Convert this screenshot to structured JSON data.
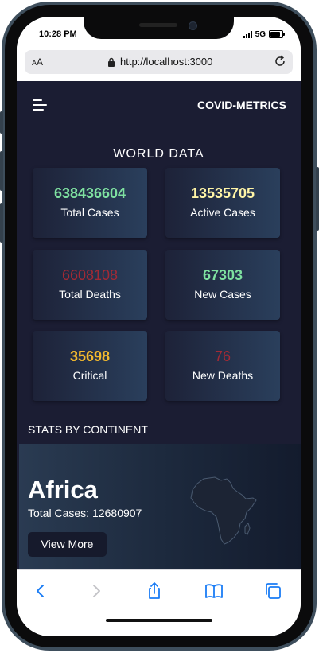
{
  "status_bar": {
    "time": "10:28 PM",
    "network": "5G"
  },
  "browser": {
    "aa_label_small": "A",
    "aa_label_large": "A",
    "url": "http://localhost:3000"
  },
  "header": {
    "brand": "COVID-METRICS"
  },
  "world_data": {
    "title": "WORLD DATA",
    "stats": [
      {
        "value": "638436604",
        "label": "Total Cases",
        "color": "#7ee0a0"
      },
      {
        "value": "13535705",
        "label": "Active Cases",
        "color": "#fff4a6"
      },
      {
        "value": "6608108",
        "label": "Total Deaths",
        "color": "#a32a35"
      },
      {
        "value": "67303",
        "label": "New Cases",
        "color": "#7ee0a0"
      },
      {
        "value": "35698",
        "label": "Critical",
        "color": "#f2b92e"
      },
      {
        "value": "76",
        "label": "New Deaths",
        "color": "#a32a35"
      }
    ]
  },
  "continents": {
    "title": "STATS BY CONTINENT",
    "items": [
      {
        "name": "Africa",
        "total_label": "Total Cases:",
        "total_value": "12680907",
        "button": "View More"
      }
    ]
  },
  "colors": {
    "app_bg": "#1b1d33",
    "card_start": "#1d2238",
    "card_end": "#2a3f5c",
    "ios_blue": "#1a7cf5"
  },
  "icons": [
    "hamburger-icon",
    "lock-icon",
    "reload-icon",
    "back-icon",
    "forward-icon",
    "share-icon",
    "bookmarks-icon",
    "tabs-icon",
    "africa-map"
  ]
}
